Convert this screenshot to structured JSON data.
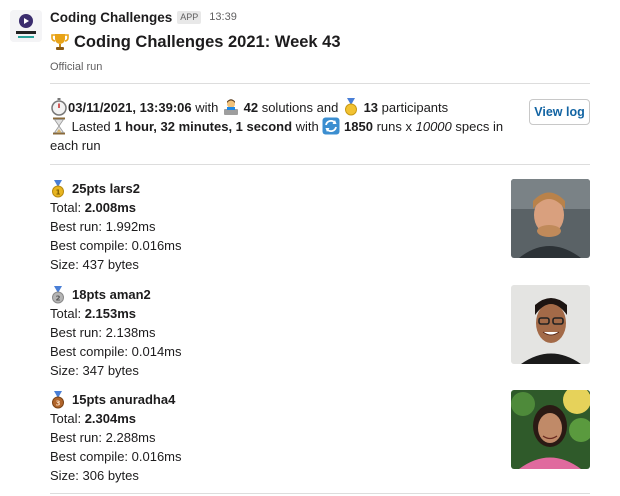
{
  "app": {
    "name": "Coding Challenges",
    "badge": "APP",
    "time": "13:39",
    "logo_text": "CODING\nCHALLENGES"
  },
  "message": {
    "title": "Coding Challenges 2021: Week 43",
    "subtitle": "Official run",
    "summary": {
      "datetime": "03/11/2021, 13:39:06",
      "with_1": "with",
      "solutions_count": "42",
      "solutions_and": "solutions and",
      "participants_count": "13",
      "participants_label": "participants",
      "lasted": "Lasted",
      "duration": "1 hour, 32 minutes, 1 second",
      "with_2": "with",
      "runs_count": "1850",
      "runs_x": "runs x",
      "specs_count": "10000",
      "specs_label": "specs in each run"
    },
    "view_log_label": "View log"
  },
  "results": [
    {
      "medal": "gold",
      "medal_color": "#e8b520",
      "points": "25pts",
      "user": "lars2",
      "total_label": "Total:",
      "total": "2.008ms",
      "best_run": "Best run: 1.992ms",
      "best_compile": "Best compile: 0.016ms",
      "size": "Size: 437 bytes"
    },
    {
      "medal": "silver",
      "medal_color": "#9a9a9a",
      "points": "18pts",
      "user": "aman2",
      "total_label": "Total:",
      "total": "2.153ms",
      "best_run": "Best run: 2.138ms",
      "best_compile": "Best compile: 0.014ms",
      "size": "Size: 347 bytes"
    },
    {
      "medal": "bronze",
      "medal_color": "#b0642a",
      "points": "15pts",
      "user": "anuradha4",
      "total_label": "Total:",
      "total": "2.304ms",
      "best_run": "Best run: 2.288ms",
      "best_compile": "Best compile: 0.016ms",
      "size": "Size: 306 bytes"
    }
  ]
}
